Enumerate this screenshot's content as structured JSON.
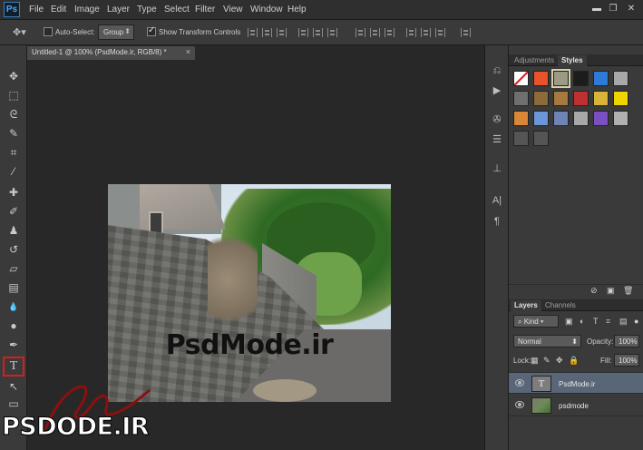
{
  "menubar": {
    "logo": "Ps",
    "items": [
      "File",
      "Edit",
      "Image",
      "Layer",
      "Type",
      "Select",
      "Filter",
      "View",
      "Window",
      "Help"
    ],
    "window_controls": [
      "▬",
      "❐",
      "✕"
    ]
  },
  "options": {
    "auto_select_label": "Auto-Select:",
    "auto_select_checked": false,
    "group_value": "Group",
    "show_transform_label": "Show Transform Controls",
    "show_transform_checked": true
  },
  "document": {
    "tab_title": "Untitled-1 @ 100% (PsdMode.ir, RGB/8) *",
    "close_symbol": "×",
    "canvas_text": "PsdMode.ir"
  },
  "tools": [
    {
      "name": "move-tool",
      "glyph": "✥"
    },
    {
      "name": "marquee-tool",
      "glyph": "⬚"
    },
    {
      "name": "lasso-tool",
      "glyph": "ᘓ"
    },
    {
      "name": "quick-select-tool",
      "glyph": "✎"
    },
    {
      "name": "crop-tool",
      "glyph": "⌗"
    },
    {
      "name": "eyedropper-tool",
      "glyph": "⁄"
    },
    {
      "name": "healing-tool",
      "glyph": "✚"
    },
    {
      "name": "brush-tool",
      "glyph": "✐"
    },
    {
      "name": "stamp-tool",
      "glyph": "♟"
    },
    {
      "name": "history-brush-tool",
      "glyph": "↺"
    },
    {
      "name": "eraser-tool",
      "glyph": "▱"
    },
    {
      "name": "gradient-tool",
      "glyph": "▤"
    },
    {
      "name": "blur-tool",
      "glyph": "💧"
    },
    {
      "name": "dodge-tool",
      "glyph": "●"
    },
    {
      "name": "pen-tool",
      "glyph": "✒"
    },
    {
      "name": "type-tool",
      "glyph": "T"
    },
    {
      "name": "path-select-tool",
      "glyph": "↖"
    },
    {
      "name": "shape-tool",
      "glyph": "▭"
    }
  ],
  "right_panel": {
    "top_tabs": [
      "Adjustments",
      "Styles"
    ],
    "active_top_tab": "Styles",
    "style_colors": [
      "#f2f2f2",
      "#e8532a",
      "#9a9a86",
      "#1c1c1c",
      "#2e7ad9",
      "#a8a8a8",
      "#6f6f6f",
      "#8b6a3b",
      "#a8793e",
      "#c12f2f",
      "#d9b23a",
      "#f0d400",
      "#d98636",
      "#6b96d8",
      "#6f84b6",
      "#a8a8a8",
      "#7a4fc2",
      "#b0b0b0",
      "#555555",
      "#555555"
    ],
    "layer_tabs": [
      "Layers",
      "Channels"
    ],
    "active_layer_tab": "Layers",
    "kind_value": "Kind",
    "blend_mode": "Normal",
    "opacity_label": "Opacity:",
    "opacity_value": "100%",
    "lock_label": "Lock:",
    "fill_label": "Fill:",
    "fill_value": "100%",
    "layers": [
      {
        "name": "PsdMode.ir",
        "type": "text",
        "thumb": "T",
        "selected": true
      },
      {
        "name": "psdmode",
        "type": "image",
        "thumb": "",
        "selected": false
      }
    ]
  },
  "watermark": {
    "text": "PSDODE.IR",
    "script_letters": "Nd"
  }
}
